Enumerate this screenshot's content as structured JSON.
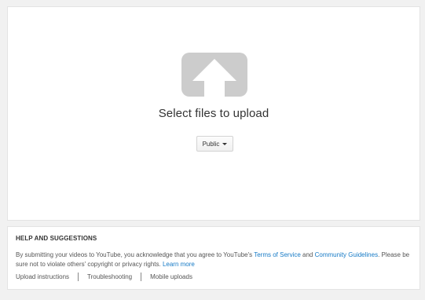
{
  "upload": {
    "title": "Select files to upload",
    "privacy_label": "Public",
    "icon": "upload-arrow-icon"
  },
  "help": {
    "heading": "HELP AND SUGGESTIONS",
    "text_1": "By submitting your videos to YouTube, you acknowledge that you agree to YouTube's ",
    "terms_link": "Terms of Service",
    "text_and": " and ",
    "guidelines_link": "Community Guidelines",
    "text_2": ". Please be sure not to violate others' copyright or privacy rights. ",
    "learn_more": "Learn more",
    "links": [
      "Upload instructions",
      "Troubleshooting",
      "Mobile uploads"
    ]
  },
  "colors": {
    "background": "#f1f1f1",
    "card": "#ffffff",
    "icon_gray": "#cccccc",
    "link_blue": "#167ac6"
  }
}
